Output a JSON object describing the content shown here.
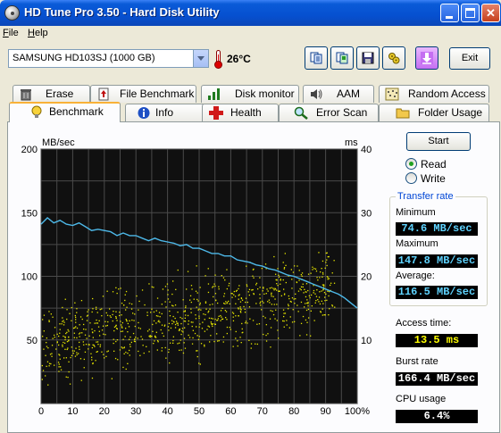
{
  "window": {
    "title": "HD Tune Pro 3.50 - Hard Disk Utility",
    "minimize_label": "",
    "maximize_label": "",
    "close_label": "✕"
  },
  "menu": {
    "file": "File",
    "file_first": "F",
    "file_rest": "ile",
    "help_first": "H",
    "help_rest": "elp"
  },
  "toolbar": {
    "drive": "SAMSUNG HD103SJ (1000 GB)",
    "temperature": "26°C",
    "icons": [
      "copy-text-icon",
      "copy-screenshot-icon",
      "save-icon",
      "options-icon",
      "download-icon"
    ],
    "exit_label": "Exit"
  },
  "tabs": {
    "row1": [
      "Erase",
      "File Benchmark",
      "Disk monitor",
      "AAM",
      "Random Access"
    ],
    "row2": [
      "Benchmark",
      "Info",
      "Health",
      "Error Scan",
      "Folder Usage"
    ],
    "active": "Benchmark"
  },
  "benchmark": {
    "start_label": "Start",
    "read_label": "Read",
    "write_label": "Write",
    "selected_mode": "Read",
    "transfer_rate_title": "Transfer rate",
    "minimum_label": "Minimum",
    "minimum_value": "74.6 MB/sec",
    "maximum_label": "Maximum",
    "maximum_value": "147.8 MB/sec",
    "average_label": "Average:",
    "average_value": "116.5 MB/sec",
    "access_time_label": "Access time:",
    "access_time_value": "13.5 ms",
    "burst_rate_label": "Burst rate",
    "burst_rate_value": "166.4 MB/sec",
    "cpu_usage_label": "CPU usage",
    "cpu_usage_value": "6.4%"
  },
  "colors": {
    "transfer_line": "#4db8e8",
    "access_points": "#e6e600",
    "plot_background": "#101010",
    "grid": "#4a4a4a"
  },
  "chart_data": {
    "type": "line",
    "left_unit": "MB/sec",
    "right_unit": "ms",
    "x_ticks": [
      "0",
      "10",
      "20",
      "30",
      "40",
      "50",
      "60",
      "70",
      "80",
      "90",
      "100%"
    ],
    "y_left_ticks": [
      "200",
      "150",
      "100",
      "50"
    ],
    "y_right_ticks": [
      "40",
      "30",
      "20",
      "10"
    ],
    "xlim": [
      0,
      100
    ],
    "ylim_left": [
      0,
      200
    ],
    "ylim_right": [
      0,
      40
    ],
    "grid": true,
    "series": [
      {
        "axis": "left",
        "x": [
          0,
          2,
          4,
          6,
          8,
          10,
          12,
          14,
          16,
          18,
          20,
          22,
          24,
          26,
          28,
          30,
          32,
          34,
          36,
          38,
          40,
          42,
          44,
          46,
          48,
          50,
          52,
          54,
          56,
          58,
          60,
          62,
          64,
          66,
          68,
          70,
          72,
          74,
          76,
          78,
          80,
          82,
          84,
          86,
          88,
          90,
          92,
          94,
          96,
          98,
          100
        ],
        "values": [
          141,
          146,
          142,
          144,
          141,
          140,
          142,
          139,
          136,
          137,
          136,
          135,
          132,
          134,
          132,
          132,
          130,
          128,
          130,
          128,
          127,
          126,
          124,
          125,
          122,
          122,
          120,
          118,
          118,
          116,
          116,
          113,
          112,
          111,
          109,
          108,
          106,
          105,
          103,
          101,
          100,
          98,
          96,
          94,
          92,
          90,
          88,
          86,
          83,
          79,
          75
        ]
      },
      {
        "axis": "right",
        "type": "scatter",
        "x_range": [
          0,
          93
        ],
        "mean_ms": 13.5,
        "min_ms": 2,
        "max_ms": 25
      }
    ]
  }
}
